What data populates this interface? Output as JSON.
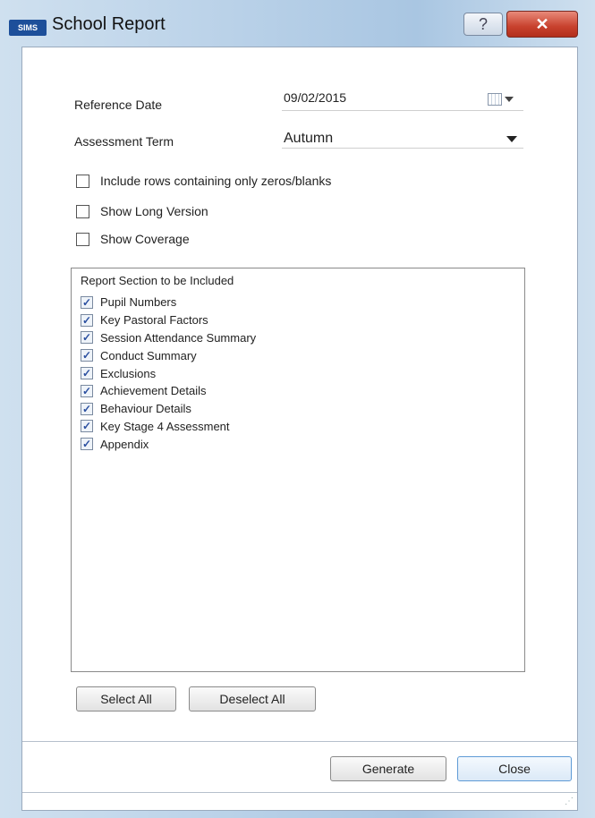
{
  "window": {
    "title": "School Report",
    "app_icon_label": "SIMS",
    "help_glyph": "?",
    "close_glyph": "✕"
  },
  "form": {
    "reference_date": {
      "label": "Reference Date",
      "value": "09/02/2015"
    },
    "assessment_term": {
      "label": "Assessment Term",
      "value": "Autumn"
    },
    "options": [
      {
        "label": "Include rows containing only zeros/blanks",
        "checked": false
      },
      {
        "label": "Show Long Version",
        "checked": false
      },
      {
        "label": "Show Coverage",
        "checked": false
      }
    ]
  },
  "sections_group": {
    "title": "Report Section to be Included",
    "items": [
      {
        "label": "Pupil Numbers",
        "checked": true
      },
      {
        "label": "Key Pastoral Factors",
        "checked": true
      },
      {
        "label": "Session Attendance Summary",
        "checked": true
      },
      {
        "label": "Conduct Summary",
        "checked": true
      },
      {
        "label": "Exclusions",
        "checked": true
      },
      {
        "label": "Achievement Details",
        "checked": true
      },
      {
        "label": "Behaviour Details",
        "checked": true
      },
      {
        "label": "Key Stage 4 Assessment",
        "checked": true
      },
      {
        "label": "Appendix",
        "checked": true
      }
    ],
    "check_glyph": "✓"
  },
  "buttons": {
    "select_all": "Select All",
    "deselect_all": "Deselect All",
    "generate": "Generate",
    "close": "Close"
  }
}
